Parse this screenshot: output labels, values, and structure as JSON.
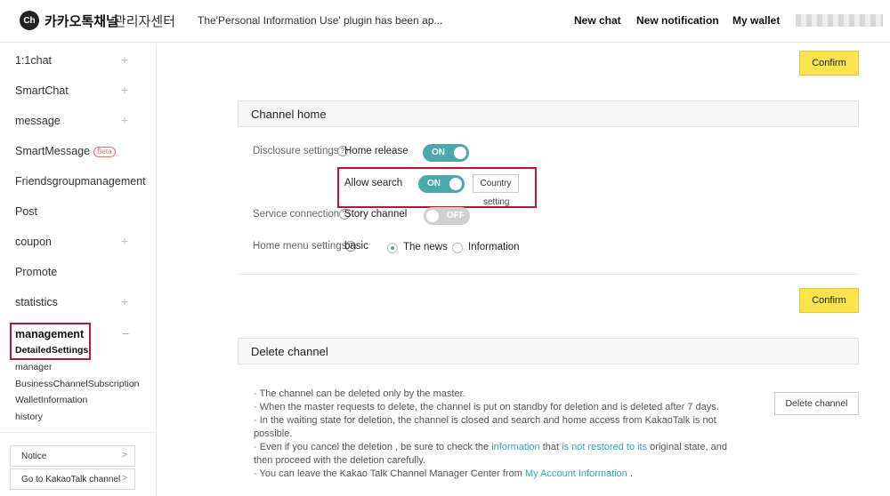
{
  "header": {
    "logo_badge": "Ch",
    "logo_text": "카카오톡채널",
    "logo_sub": "관리자센터",
    "notice": "The'Personal Information Use' plugin has been ap...",
    "nav": [
      "New chat",
      "New notification",
      "My wallet"
    ]
  },
  "sidebar": {
    "items": [
      {
        "label": "1:1chat",
        "plus": "+"
      },
      {
        "label": "SmartChat",
        "plus": "+"
      },
      {
        "label": "message",
        "plus": "+"
      },
      {
        "label": "SmartMessage",
        "badge": "Beta",
        "plus": ""
      },
      {
        "label": "Friendsgroupmanagement",
        "plus": ""
      },
      {
        "label": "Post",
        "plus": ""
      },
      {
        "label": "coupon",
        "plus": "+"
      },
      {
        "label": "Promote",
        "plus": ""
      },
      {
        "label": "statistics",
        "plus": "+"
      }
    ],
    "management": {
      "label": "management",
      "minus": "−",
      "subs": [
        "DetailedSettings",
        "manager",
        "BusinessChannelSubscription",
        "WalletInformation",
        "history"
      ]
    },
    "buttons": [
      "Notice",
      "Go to KakaoTalk channel"
    ]
  },
  "main": {
    "confirm": "Confirm",
    "channel_home": {
      "title": "Channel home",
      "disclosure_label": "Disclosure settings",
      "home_release": "Home release",
      "home_release_toggle": "ON",
      "allow_search": "Allow search",
      "allow_search_toggle": "ON",
      "country_btn": "Country",
      "country_sub": "setting",
      "service_label": "Service connection",
      "story_channel": "Story channel",
      "story_toggle": "OFF",
      "home_menu_label": "Home menu settings",
      "home_menu_value": "basic",
      "radio_news": "The news",
      "radio_info": "Information"
    },
    "delete_channel": {
      "title": "Delete channel",
      "button": "Delete channel",
      "b1": "The channel can be deleted only by the master.",
      "b2": "When the master requests to delete, the channel is put on standby for deletion and is deleted after 7 days.",
      "b3": "In the waiting state for deletion, the channel is closed and search and home access from KakaoTalk is not possible.",
      "b4_a": "Even if you cancel the deletion , be sure to check the ",
      "b4_link1": "information",
      "b4_b": " that ",
      "b4_link2": "is not restored to its",
      "b4_c": " original state, and then proceed with the deletion carefully.",
      "b5_a": "You can leave the Kakao Talk Channel Manager Center from ",
      "b5_link": "My Account Information",
      "b5_b": " ."
    }
  }
}
